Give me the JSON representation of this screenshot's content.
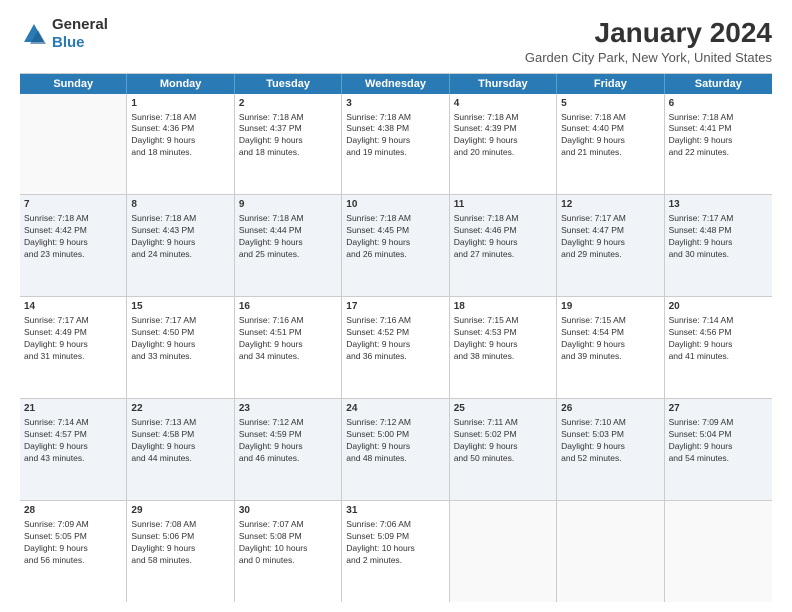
{
  "logo": {
    "general": "General",
    "blue": "Blue"
  },
  "title": "January 2024",
  "subtitle": "Garden City Park, New York, United States",
  "header_days": [
    "Sunday",
    "Monday",
    "Tuesday",
    "Wednesday",
    "Thursday",
    "Friday",
    "Saturday"
  ],
  "rows": [
    [
      {
        "day": "",
        "lines": [],
        "empty": true
      },
      {
        "day": "1",
        "lines": [
          "Sunrise: 7:18 AM",
          "Sunset: 4:36 PM",
          "Daylight: 9 hours",
          "and 18 minutes."
        ],
        "shaded": false
      },
      {
        "day": "2",
        "lines": [
          "Sunrise: 7:18 AM",
          "Sunset: 4:37 PM",
          "Daylight: 9 hours",
          "and 18 minutes."
        ],
        "shaded": false
      },
      {
        "day": "3",
        "lines": [
          "Sunrise: 7:18 AM",
          "Sunset: 4:38 PM",
          "Daylight: 9 hours",
          "and 19 minutes."
        ],
        "shaded": false
      },
      {
        "day": "4",
        "lines": [
          "Sunrise: 7:18 AM",
          "Sunset: 4:39 PM",
          "Daylight: 9 hours",
          "and 20 minutes."
        ],
        "shaded": false
      },
      {
        "day": "5",
        "lines": [
          "Sunrise: 7:18 AM",
          "Sunset: 4:40 PM",
          "Daylight: 9 hours",
          "and 21 minutes."
        ],
        "shaded": false
      },
      {
        "day": "6",
        "lines": [
          "Sunrise: 7:18 AM",
          "Sunset: 4:41 PM",
          "Daylight: 9 hours",
          "and 22 minutes."
        ],
        "shaded": false
      }
    ],
    [
      {
        "day": "7",
        "lines": [
          "Sunrise: 7:18 AM",
          "Sunset: 4:42 PM",
          "Daylight: 9 hours",
          "and 23 minutes."
        ],
        "shaded": true
      },
      {
        "day": "8",
        "lines": [
          "Sunrise: 7:18 AM",
          "Sunset: 4:43 PM",
          "Daylight: 9 hours",
          "and 24 minutes."
        ],
        "shaded": true
      },
      {
        "day": "9",
        "lines": [
          "Sunrise: 7:18 AM",
          "Sunset: 4:44 PM",
          "Daylight: 9 hours",
          "and 25 minutes."
        ],
        "shaded": true
      },
      {
        "day": "10",
        "lines": [
          "Sunrise: 7:18 AM",
          "Sunset: 4:45 PM",
          "Daylight: 9 hours",
          "and 26 minutes."
        ],
        "shaded": true
      },
      {
        "day": "11",
        "lines": [
          "Sunrise: 7:18 AM",
          "Sunset: 4:46 PM",
          "Daylight: 9 hours",
          "and 27 minutes."
        ],
        "shaded": true
      },
      {
        "day": "12",
        "lines": [
          "Sunrise: 7:17 AM",
          "Sunset: 4:47 PM",
          "Daylight: 9 hours",
          "and 29 minutes."
        ],
        "shaded": true
      },
      {
        "day": "13",
        "lines": [
          "Sunrise: 7:17 AM",
          "Sunset: 4:48 PM",
          "Daylight: 9 hours",
          "and 30 minutes."
        ],
        "shaded": true
      }
    ],
    [
      {
        "day": "14",
        "lines": [
          "Sunrise: 7:17 AM",
          "Sunset: 4:49 PM",
          "Daylight: 9 hours",
          "and 31 minutes."
        ],
        "shaded": false
      },
      {
        "day": "15",
        "lines": [
          "Sunrise: 7:17 AM",
          "Sunset: 4:50 PM",
          "Daylight: 9 hours",
          "and 33 minutes."
        ],
        "shaded": false
      },
      {
        "day": "16",
        "lines": [
          "Sunrise: 7:16 AM",
          "Sunset: 4:51 PM",
          "Daylight: 9 hours",
          "and 34 minutes."
        ],
        "shaded": false
      },
      {
        "day": "17",
        "lines": [
          "Sunrise: 7:16 AM",
          "Sunset: 4:52 PM",
          "Daylight: 9 hours",
          "and 36 minutes."
        ],
        "shaded": false
      },
      {
        "day": "18",
        "lines": [
          "Sunrise: 7:15 AM",
          "Sunset: 4:53 PM",
          "Daylight: 9 hours",
          "and 38 minutes."
        ],
        "shaded": false
      },
      {
        "day": "19",
        "lines": [
          "Sunrise: 7:15 AM",
          "Sunset: 4:54 PM",
          "Daylight: 9 hours",
          "and 39 minutes."
        ],
        "shaded": false
      },
      {
        "day": "20",
        "lines": [
          "Sunrise: 7:14 AM",
          "Sunset: 4:56 PM",
          "Daylight: 9 hours",
          "and 41 minutes."
        ],
        "shaded": false
      }
    ],
    [
      {
        "day": "21",
        "lines": [
          "Sunrise: 7:14 AM",
          "Sunset: 4:57 PM",
          "Daylight: 9 hours",
          "and 43 minutes."
        ],
        "shaded": true
      },
      {
        "day": "22",
        "lines": [
          "Sunrise: 7:13 AM",
          "Sunset: 4:58 PM",
          "Daylight: 9 hours",
          "and 44 minutes."
        ],
        "shaded": true
      },
      {
        "day": "23",
        "lines": [
          "Sunrise: 7:12 AM",
          "Sunset: 4:59 PM",
          "Daylight: 9 hours",
          "and 46 minutes."
        ],
        "shaded": true
      },
      {
        "day": "24",
        "lines": [
          "Sunrise: 7:12 AM",
          "Sunset: 5:00 PM",
          "Daylight: 9 hours",
          "and 48 minutes."
        ],
        "shaded": true
      },
      {
        "day": "25",
        "lines": [
          "Sunrise: 7:11 AM",
          "Sunset: 5:02 PM",
          "Daylight: 9 hours",
          "and 50 minutes."
        ],
        "shaded": true
      },
      {
        "day": "26",
        "lines": [
          "Sunrise: 7:10 AM",
          "Sunset: 5:03 PM",
          "Daylight: 9 hours",
          "and 52 minutes."
        ],
        "shaded": true
      },
      {
        "day": "27",
        "lines": [
          "Sunrise: 7:09 AM",
          "Sunset: 5:04 PM",
          "Daylight: 9 hours",
          "and 54 minutes."
        ],
        "shaded": true
      }
    ],
    [
      {
        "day": "28",
        "lines": [
          "Sunrise: 7:09 AM",
          "Sunset: 5:05 PM",
          "Daylight: 9 hours",
          "and 56 minutes."
        ],
        "shaded": false
      },
      {
        "day": "29",
        "lines": [
          "Sunrise: 7:08 AM",
          "Sunset: 5:06 PM",
          "Daylight: 9 hours",
          "and 58 minutes."
        ],
        "shaded": false
      },
      {
        "day": "30",
        "lines": [
          "Sunrise: 7:07 AM",
          "Sunset: 5:08 PM",
          "Daylight: 10 hours",
          "and 0 minutes."
        ],
        "shaded": false
      },
      {
        "day": "31",
        "lines": [
          "Sunrise: 7:06 AM",
          "Sunset: 5:09 PM",
          "Daylight: 10 hours",
          "and 2 minutes."
        ],
        "shaded": false
      },
      {
        "day": "",
        "lines": [],
        "empty": true
      },
      {
        "day": "",
        "lines": [],
        "empty": true
      },
      {
        "day": "",
        "lines": [],
        "empty": true
      }
    ]
  ]
}
